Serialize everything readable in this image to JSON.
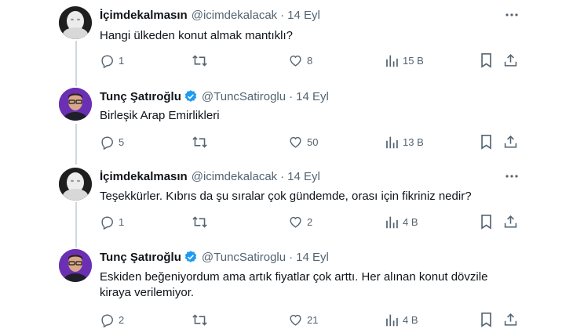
{
  "tweets": [
    {
      "author": "İçimdekalmasın",
      "handle": "@icimdekalacak",
      "separator": "·",
      "date": "14 Eyl",
      "verified": false,
      "avatar": "ghost-mask-avatar",
      "text_lines": [
        "Hangi ülkeden konut almak mantıklı?"
      ],
      "replies": "1",
      "retweets": "",
      "likes": "8",
      "views": "15 B"
    },
    {
      "author": "Tunç Şatıroğlu",
      "handle": "@TuncSatiroglu",
      "separator": "·",
      "date": "14 Eyl",
      "verified": true,
      "avatar": "man-with-glasses-avatar",
      "text_lines": [
        "Birleşik Arap Emirlikleri"
      ],
      "replies": "5",
      "retweets": "",
      "likes": "50",
      "views": "13 B"
    },
    {
      "author": "İçimdekalmasın",
      "handle": "@icimdekalacak",
      "separator": "·",
      "date": "14 Eyl",
      "verified": false,
      "avatar": "ghost-mask-avatar",
      "text_lines": [
        "Teşekkürler. Kıbrıs da şu sıralar çok gündemde, orası için fikriniz nedir?"
      ],
      "replies": "1",
      "retweets": "",
      "likes": "2",
      "views": "4 B"
    },
    {
      "author": "Tunç Şatıroğlu",
      "handle": "@TuncSatiroglu",
      "separator": "·",
      "date": "14 Eyl",
      "verified": true,
      "avatar": "man-with-glasses-avatar",
      "text_lines": [
        "Eskiden beğeniyordum ama artık fiyatlar çok arttı. Her alınan konut dövzile",
        "kiraya verilemiyor."
      ],
      "replies": "2",
      "retweets": "",
      "likes": "21",
      "views": "4 B"
    }
  ],
  "colors": {
    "text": "#0f1419",
    "muted": "#536471",
    "verified_blue": "#1d9bf0",
    "thread_line": "#cfd9de"
  },
  "icons": [
    "more-icon",
    "reply-icon",
    "retweet-icon",
    "like-icon",
    "views-icon",
    "bookmark-icon",
    "share-icon",
    "verified-icon"
  ]
}
